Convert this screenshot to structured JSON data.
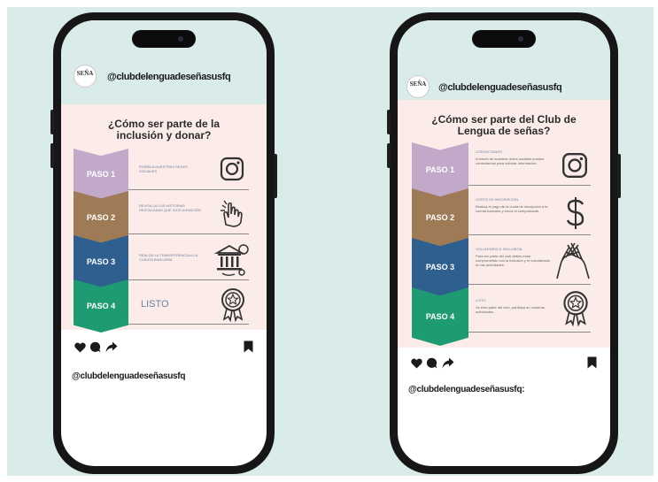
{
  "left_phone": {
    "avatar_text": "SEÑA",
    "username": "@clubdelenguadeseñasusfq",
    "post_title": "¿Cómo ser parte de la inclusión y donar?",
    "steps": [
      {
        "label": "PASO 1",
        "text": "ROBÍSLA NUESTRAS REDES SOCIALES"
      },
      {
        "label": "PASO 2",
        "text": "REVISA LA LOS HISTORIAS DESTACADAS QUE DICE DONACIÓN"
      },
      {
        "label": "PASO 3",
        "text": "REALIZA LA TRANSFERENCIA A LA CUENTA BANCARIA"
      },
      {
        "label": "PASO 4",
        "text": "LISTO"
      }
    ],
    "icons": [
      "instagram-icon",
      "hand-tap-icon",
      "bank-transfer-icon",
      "award-badge-icon"
    ],
    "caption": "@clubdelenguadeseñasusfq"
  },
  "right_phone": {
    "avatar_text": "SEÑA",
    "username": "@clubdelenguadeseñasusfq",
    "post_title": "¿Cómo ser parte del Club de Lengua de señas?",
    "steps": [
      {
        "label": "PASO 1",
        "heading": "CONTACTANOS",
        "text": "A través de nuestras redes sociales puedes contactarnos para solicitar información."
      },
      {
        "label": "PASO 2",
        "heading": "COSTO DE INSCRIPCIÓN",
        "text": "Realiza el pago de la cuota de inscripción a la cuenta bancaria y envía el comprobante."
      },
      {
        "label": "PASO 3",
        "heading": "VOLUNTARIO E INCLUSIÓN",
        "text": "Para ser parte del club debes estar comprometido con la inclusión y el voluntariado en las actividades."
      },
      {
        "label": "PASO 4",
        "heading": "LISTO",
        "text": "Ya eres parte del club, participa en nuestras actividades."
      }
    ],
    "icons": [
      "instagram-icon",
      "dollar-icon",
      "helping-hands-icon",
      "award-badge-icon"
    ],
    "caption": "@clubdelenguadeseñasusfq:"
  },
  "colors": {
    "background": "#d9ecea",
    "post_background": "#fcece9",
    "paso1": "#c3a9c9",
    "paso2": "#9f7a56",
    "paso3": "#2f5f8f",
    "paso4": "#1e9b72",
    "phone_frame": "#161616"
  }
}
